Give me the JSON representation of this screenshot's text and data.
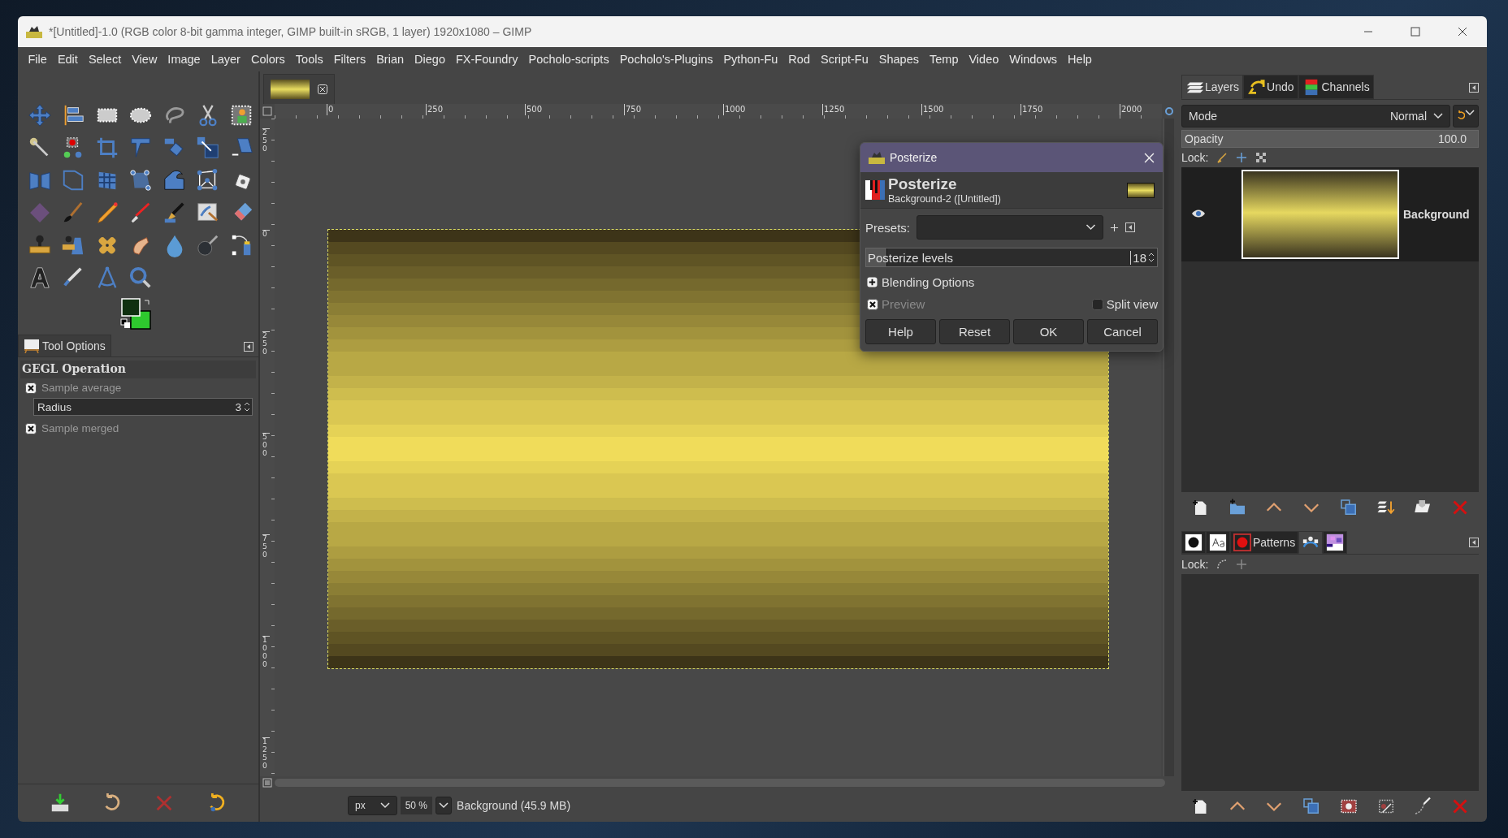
{
  "window": {
    "title": "*[Untitled]-1.0 (RGB color 8-bit gamma integer, GIMP built-in sRGB, 1 layer) 1920x1080 – GIMP"
  },
  "menu": [
    "File",
    "Edit",
    "Select",
    "View",
    "Image",
    "Layer",
    "Colors",
    "Tools",
    "Filters",
    "Brian",
    "Diego",
    "FX-Foundry",
    "Pocholo-scripts",
    "Pocholo's-Plugins",
    "Python-Fu",
    "Rod",
    "Script-Fu",
    "Shapes",
    "Temp",
    "Video",
    "Windows",
    "Help"
  ],
  "tool_options": {
    "tab": "Tool Options",
    "title": "GEGL Operation",
    "options": [
      {
        "kind": "checkbox",
        "label": "Sample average",
        "checked": true
      },
      {
        "kind": "spin",
        "label": "Radius",
        "value": "3"
      },
      {
        "kind": "checkbox",
        "label": "Sample merged",
        "checked": true
      }
    ]
  },
  "rulers": {
    "horizontal": [
      "0",
      "250",
      "500",
      "750",
      "1000",
      "1250",
      "1500",
      "1750",
      "2000"
    ],
    "vertical": [
      "250",
      "0",
      "250",
      "500",
      "750",
      "1000",
      "1250"
    ]
  },
  "status_bar": {
    "unit": "px",
    "zoom": "50 %",
    "message": "Background (45.9 MB)"
  },
  "dialog": {
    "title": "Posterize",
    "heading": "Posterize",
    "subtitle": "Background-2 ([Untitled])",
    "presets_label": "Presets:",
    "slider": {
      "label": "Posterize levels",
      "value": "18",
      "level": 0.07
    },
    "blending": "Blending Options",
    "preview": {
      "label": "Preview",
      "checked": true
    },
    "split_view": {
      "label": "Split view",
      "checked": false
    },
    "buttons": [
      "Help",
      "Reset",
      "OK",
      "Cancel"
    ]
  },
  "layers_panel": {
    "tabs": [
      {
        "label": "Layers",
        "kind": "layers",
        "selected": true
      },
      {
        "label": "Undo",
        "kind": "undo",
        "selected": false
      },
      {
        "label": "Channels",
        "kind": "channels",
        "selected": false
      }
    ],
    "mode_label": "Mode",
    "mode": "Normal",
    "opacity": {
      "label": "Opacity",
      "value": "100.0",
      "level": 1
    },
    "lock_label": "Lock:",
    "layers": [
      {
        "name": "Background",
        "visible": true,
        "selected": true
      }
    ]
  },
  "paths_panel": {
    "tabs": [
      {
        "kind": "brush",
        "selected": false
      },
      {
        "kind": "font",
        "selected": false
      },
      {
        "kind": "pattern",
        "label": "Patterns",
        "selected": false
      },
      {
        "kind": "paths",
        "selected": true
      },
      {
        "kind": "palette",
        "selected": false
      }
    ],
    "lock_label": "Lock:"
  }
}
